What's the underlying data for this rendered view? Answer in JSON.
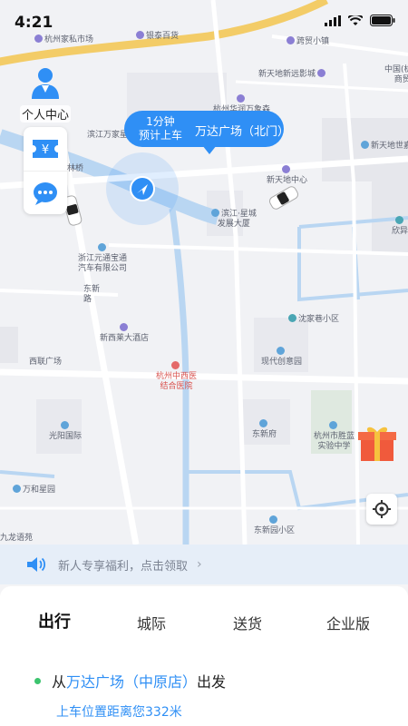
{
  "status_bar": {
    "time": "4:21"
  },
  "map": {
    "pois": {
      "jiasi": "杭州家私市场",
      "yintai": "银泰百货",
      "kuaqiao": "跨贸小镇",
      "cinema": "新天地新远影城",
      "zhongguo": "中国(杭州",
      "shangshou": "商贸",
      "huafa": "杭州华润万象森",
      "binjiang_wanjia": "滨江万家星",
      "newtiandi_center": "新天地中心",
      "newtiandi_world": "新天地世嘉",
      "xingcheng_1": "滨江·星城",
      "xingcheng_2": "发展大厦",
      "xinxing": "欣异",
      "zhetong_1": "浙江元通宝通",
      "zhetong_2": "汽车有限公司",
      "dongxin_1": "东新",
      "dongxin_2": "路",
      "xinxi_hotel": "新西莱大酒店",
      "shenjia": "沈家巷小区",
      "xilian": "西联广场",
      "modern": "现代创意园",
      "hospital_1": "杭州中西医",
      "hospital_2": "结合医院",
      "guangyang": "光阳国际",
      "dongxinfu": "东新府",
      "school_1": "杭州市胜蓝",
      "school_2": "实验中学",
      "wanhe": "万和星园",
      "longyuan": "九龙语苑",
      "dongxinyuan": "东新园小区",
      "qiaoqiao": "林桥"
    }
  },
  "profile": {
    "label": "个人中心"
  },
  "side_buttons": [
    "ticket-icon",
    "message-icon"
  ],
  "pickup_bubble": {
    "eta_line1": "1分钟",
    "eta_line2": "预计上车",
    "place": "万达广场（北门）"
  },
  "promo": {
    "text": "新人专享福利，点击领取",
    "chevron": "›"
  },
  "tabs": [
    {
      "label": "出行",
      "active": true
    },
    {
      "label": "城际",
      "active": false
    },
    {
      "label": "送货",
      "active": false
    },
    {
      "label": "企业版",
      "active": false
    }
  ],
  "origin": {
    "prefix": "从",
    "place": "万达广场（中原店）",
    "suffix": "出发"
  },
  "distance": "上车位置距离您332米",
  "colors": {
    "accent": "#2f8ff5",
    "origin_dot": "#3cc46e",
    "promo_bg": "#e6eef8"
  }
}
